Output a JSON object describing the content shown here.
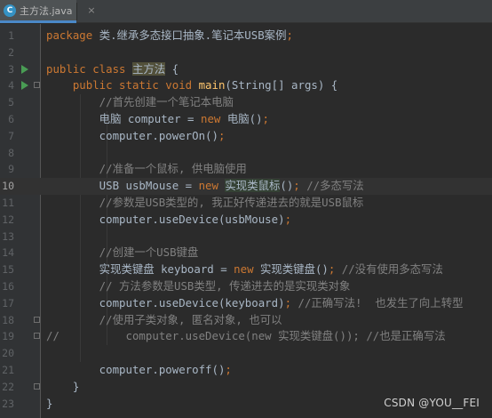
{
  "tab": {
    "icon": "java-class-icon",
    "icon_letter": "C",
    "label": "主方法.java",
    "close": "×"
  },
  "lines": [
    {
      "n": "1",
      "parts": [
        {
          "t": "package ",
          "c": "kw"
        },
        {
          "t": "类.继承多态接口抽象.笔记本USB案例",
          "c": ""
        },
        {
          "t": ";",
          "c": "kw"
        }
      ]
    },
    {
      "n": "2",
      "parts": []
    },
    {
      "n": "3",
      "run": true,
      "parts": [
        {
          "t": "public class ",
          "c": "kw"
        },
        {
          "t": "主方法",
          "c": "hl-yellow"
        },
        {
          "t": " {",
          "c": ""
        }
      ]
    },
    {
      "n": "4",
      "run": true,
      "fold": true,
      "parts": [
        {
          "t": "    public static void ",
          "c": "kw"
        },
        {
          "t": "main",
          "c": "fn"
        },
        {
          "t": "(String[] args) {",
          "c": ""
        }
      ]
    },
    {
      "n": "5",
      "parts": [
        {
          "t": "        //首先创建一个笔记本电脑",
          "c": "cm"
        }
      ]
    },
    {
      "n": "6",
      "parts": [
        {
          "t": "        电脑 computer = ",
          "c": ""
        },
        {
          "t": "new ",
          "c": "kw"
        },
        {
          "t": "电脑()",
          "c": ""
        },
        {
          "t": ";",
          "c": "kw"
        }
      ]
    },
    {
      "n": "7",
      "parts": [
        {
          "t": "        computer.powerOn()",
          "c": ""
        },
        {
          "t": ";",
          "c": "kw"
        }
      ]
    },
    {
      "n": "8",
      "parts": []
    },
    {
      "n": "9",
      "parts": [
        {
          "t": "        //准备一个鼠标, 供电脑使用",
          "c": "cm"
        }
      ]
    },
    {
      "n": "10",
      "current": true,
      "parts": [
        {
          "t": "        USB usbMouse = ",
          "c": ""
        },
        {
          "t": "new ",
          "c": "kw"
        },
        {
          "t": "实现类鼠标",
          "c": "hl-green"
        },
        {
          "t": "()",
          "c": ""
        },
        {
          "t": "; ",
          "c": "kw"
        },
        {
          "t": "//多态写法",
          "c": "cm"
        }
      ]
    },
    {
      "n": "11",
      "parts": [
        {
          "t": "        //参数是USB类型的, 我正好传递进去的就是USB鼠标",
          "c": "cm"
        }
      ]
    },
    {
      "n": "12",
      "parts": [
        {
          "t": "        computer.useDevice(usbMouse)",
          "c": ""
        },
        {
          "t": ";",
          "c": "kw"
        }
      ]
    },
    {
      "n": "13",
      "parts": []
    },
    {
      "n": "14",
      "parts": [
        {
          "t": "        //创建一个USB键盘",
          "c": "cm"
        }
      ]
    },
    {
      "n": "15",
      "parts": [
        {
          "t": "        实现类键盘 keyboard = ",
          "c": ""
        },
        {
          "t": "new ",
          "c": "kw"
        },
        {
          "t": "实现类键盘()",
          "c": ""
        },
        {
          "t": "; ",
          "c": "kw"
        },
        {
          "t": "//没有使用多态写法",
          "c": "cm"
        }
      ]
    },
    {
      "n": "16",
      "parts": [
        {
          "t": "        // 方法参数是USB类型, 传递进去的是实现类对象",
          "c": "cm"
        }
      ]
    },
    {
      "n": "17",
      "parts": [
        {
          "t": "        computer.useDevice(keyboard)",
          "c": ""
        },
        {
          "t": "; ",
          "c": "kw"
        },
        {
          "t": "//正确写法!  也发生了向上转型",
          "c": "cm"
        }
      ]
    },
    {
      "n": "18",
      "fold": true,
      "parts": [
        {
          "t": "        //使用子类对象, 匿名对象, 也可以",
          "c": "cm"
        }
      ]
    },
    {
      "n": "19",
      "fold": true,
      "parts": [
        {
          "t": "//          computer.useDevice(new 实现类键盘()); //也是正确写法",
          "c": "cm"
        }
      ]
    },
    {
      "n": "20",
      "parts": []
    },
    {
      "n": "21",
      "parts": [
        {
          "t": "        computer.poweroff()",
          "c": ""
        },
        {
          "t": ";",
          "c": "kw"
        }
      ]
    },
    {
      "n": "22",
      "fold": true,
      "parts": [
        {
          "t": "    }",
          "c": ""
        }
      ]
    },
    {
      "n": "23",
      "parts": [
        {
          "t": "}",
          "c": ""
        }
      ]
    }
  ],
  "watermark": "CSDN @YOU__FEI",
  "colors": {
    "background": "#2b2b2b",
    "keyword": "#cc7832",
    "comment": "#808080",
    "method": "#ffc66d",
    "text": "#a9b7c6"
  }
}
